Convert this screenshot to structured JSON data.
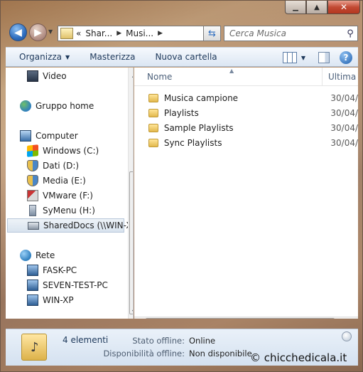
{
  "window": {
    "caption_minimize": "▁",
    "caption_maximize": "▲",
    "caption_close": "✕"
  },
  "address_bar": {
    "back_label": "◀",
    "forward_label": "▶",
    "prefix": "«",
    "crumbs": [
      "Shar...",
      "Musi..."
    ],
    "search_placeholder": "Cerca Musica"
  },
  "toolbar": {
    "organize_label": "Organizza",
    "burn_label": "Masterizza",
    "new_folder_label": "Nuova cartella",
    "help_label": "?"
  },
  "nav_pane": {
    "items": [
      {
        "label": "Video",
        "icon": "video-icon"
      },
      {
        "label": "Gruppo home",
        "icon": "homegroup-icon"
      },
      {
        "label": "Computer",
        "icon": "computer-icon"
      },
      {
        "label": "Windows (C:)",
        "icon": "windows-drive-icon"
      },
      {
        "label": "Dati (D:)",
        "icon": "drive-icon"
      },
      {
        "label": "Media (E:)",
        "icon": "drive-icon"
      },
      {
        "label": "VMware  (F:)",
        "icon": "vmware-drive-icon"
      },
      {
        "label": "SyMenu (H:)",
        "icon": "usb-drive-icon"
      },
      {
        "label": "SharedDocs (\\\\WIN-X",
        "icon": "network-drive-icon"
      },
      {
        "label": "Rete",
        "icon": "network-icon"
      },
      {
        "label": "FASK-PC",
        "icon": "pc-icon"
      },
      {
        "label": "SEVEN-TEST-PC",
        "icon": "pc-icon"
      },
      {
        "label": "WIN-XP",
        "icon": "pc-icon"
      }
    ]
  },
  "file_list": {
    "columns": [
      "Nome",
      "Ultima"
    ],
    "rows": [
      {
        "name": "Musica campione",
        "date": "30/04/"
      },
      {
        "name": "Playlists",
        "date": "30/04/"
      },
      {
        "name": "Sample Playlists",
        "date": "30/04/"
      },
      {
        "name": "Sync Playlists",
        "date": "30/04/"
      }
    ]
  },
  "details": {
    "count": "4 elementi",
    "offline_status_label": "Stato offline:",
    "offline_status_value": "Online",
    "offline_availability_label": "Disponibilità offline:",
    "offline_availability_value": "Non disponibile"
  },
  "watermark": "© chicchedicala.it"
}
